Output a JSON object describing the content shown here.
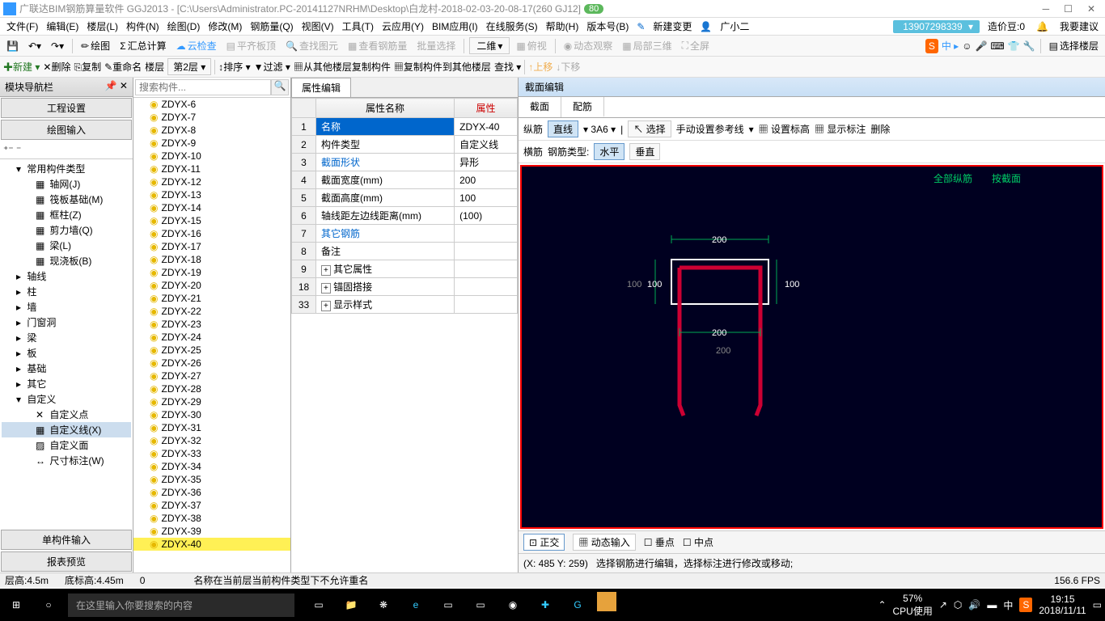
{
  "title": "广联达BIM钢筋算量软件 GGJ2013 - [C:\\Users\\Administrator.PC-20141127NRHM\\Desktop\\白龙村-2018-02-03-20-08-17(260 GJ12]",
  "badge": "80",
  "menu": [
    "文件(F)",
    "编辑(E)",
    "楼层(L)",
    "构件(N)",
    "绘图(D)",
    "修改(M)",
    "钢筋量(Q)",
    "视图(V)",
    "工具(T)",
    "云应用(Y)",
    "BIM应用(I)",
    "在线服务(S)",
    "帮助(H)",
    "版本号(B)"
  ],
  "menuRight": {
    "newChange": "新建变更",
    "user": "广小二",
    "phone": "13907298339",
    "cost": "造价豆:0",
    "suggest": "我要建议"
  },
  "toolbar1": [
    "绘图",
    "汇总计算",
    "云检查",
    "平齐板顶",
    "查找图元",
    "查看钢筋量",
    "批量选择",
    "二维",
    "俯视",
    "动态观察",
    "局部三维",
    "全屏",
    "选择楼层"
  ],
  "toolbar2": {
    "new": "新建",
    "del": "删除",
    "copy": "复制",
    "rename": "重命名",
    "floor": "楼层",
    "floorNum": "第2层",
    "sort": "排序",
    "filter": "过滤",
    "copyFrom": "从其他楼层复制构件",
    "copyTo": "复制构件到其他楼层",
    "find": "查找",
    "up": "上移",
    "down": "下移"
  },
  "leftHeader": "模块导航栏",
  "sections": {
    "proj": "工程设置",
    "draw": "绘图输入",
    "single": "单构件输入",
    "report": "报表预览"
  },
  "tree": [
    {
      "l": 1,
      "exp": "▾",
      "t": "常用构件类型"
    },
    {
      "l": 2,
      "ico": "▦",
      "t": "轴网(J)"
    },
    {
      "l": 2,
      "ico": "▦",
      "t": "筏板基础(M)"
    },
    {
      "l": 2,
      "ico": "▦",
      "t": "框柱(Z)"
    },
    {
      "l": 2,
      "ico": "▦",
      "t": "剪力墙(Q)"
    },
    {
      "l": 2,
      "ico": "▦",
      "t": "梁(L)"
    },
    {
      "l": 2,
      "ico": "▦",
      "t": "现浇板(B)"
    },
    {
      "l": 1,
      "exp": "▸",
      "t": "轴线"
    },
    {
      "l": 1,
      "exp": "▸",
      "t": "柱"
    },
    {
      "l": 1,
      "exp": "▸",
      "t": "墙"
    },
    {
      "l": 1,
      "exp": "▸",
      "t": "门窗洞"
    },
    {
      "l": 1,
      "exp": "▸",
      "t": "梁"
    },
    {
      "l": 1,
      "exp": "▸",
      "t": "板"
    },
    {
      "l": 1,
      "exp": "▸",
      "t": "基础"
    },
    {
      "l": 1,
      "exp": "▸",
      "t": "其它"
    },
    {
      "l": 1,
      "exp": "▾",
      "t": "自定义"
    },
    {
      "l": 2,
      "ico": "✕",
      "t": "自定义点"
    },
    {
      "l": 2,
      "ico": "▦",
      "t": "自定义线(X)",
      "sel": true
    },
    {
      "l": 2,
      "ico": "▨",
      "t": "自定义面"
    },
    {
      "l": 2,
      "ico": "↔",
      "t": "尺寸标注(W)"
    }
  ],
  "searchPlaceholder": "搜索构件...",
  "itemList": [
    "ZDYX-6",
    "ZDYX-7",
    "ZDYX-8",
    "ZDYX-9",
    "ZDYX-10",
    "ZDYX-11",
    "ZDYX-12",
    "ZDYX-13",
    "ZDYX-14",
    "ZDYX-15",
    "ZDYX-16",
    "ZDYX-17",
    "ZDYX-18",
    "ZDYX-19",
    "ZDYX-20",
    "ZDYX-21",
    "ZDYX-22",
    "ZDYX-23",
    "ZDYX-24",
    "ZDYX-25",
    "ZDYX-26",
    "ZDYX-27",
    "ZDYX-28",
    "ZDYX-29",
    "ZDYX-30",
    "ZDYX-31",
    "ZDYX-32",
    "ZDYX-33",
    "ZDYX-34",
    "ZDYX-35",
    "ZDYX-36",
    "ZDYX-37",
    "ZDYX-38",
    "ZDYX-39",
    "ZDYX-40"
  ],
  "itemSelected": "ZDYX-40",
  "propTab": "属性编辑",
  "propHeaders": {
    "name": "属性名称",
    "val": "属性"
  },
  "props": [
    {
      "n": "1",
      "k": "名称",
      "v": "ZDYX-40",
      "sel": true
    },
    {
      "n": "2",
      "k": "构件类型",
      "v": "自定义线"
    },
    {
      "n": "3",
      "k": "截面形状",
      "v": "异形",
      "link": true
    },
    {
      "n": "4",
      "k": "截面宽度(mm)",
      "v": "200"
    },
    {
      "n": "5",
      "k": "截面高度(mm)",
      "v": "100"
    },
    {
      "n": "6",
      "k": "轴线距左边线距离(mm)",
      "v": "(100)"
    },
    {
      "n": "7",
      "k": "其它钢筋",
      "v": "",
      "link": true
    },
    {
      "n": "8",
      "k": "备注",
      "v": ""
    },
    {
      "n": "9",
      "k": "其它属性",
      "v": "",
      "exp": "+"
    },
    {
      "n": "18",
      "k": "锚固搭接",
      "v": "",
      "exp": "+"
    },
    {
      "n": "33",
      "k": "显示样式",
      "v": "",
      "exp": "+"
    }
  ],
  "sectionHdr": "截面编辑",
  "secTabs": {
    "section": "截面",
    "rebar": "配筋"
  },
  "secTb1": {
    "vbar": "纵筋",
    "line": "直线",
    "spec": "3A6",
    "select": "选择",
    "manual": "手动设置参考线",
    "elev": "设置标高",
    "show": "显示标注",
    "del": "删除"
  },
  "secTb2": {
    "hbar": "横筋",
    "type": "钢筋类型:",
    "horiz": "水平",
    "vert": "垂直"
  },
  "canvasLabels": {
    "allV": "全部纵筋",
    "bySec": "按截面",
    "d200a": "200",
    "d100l": "100",
    "d100l2": "100",
    "d100r": "100",
    "d200b": "200",
    "d200c": "200"
  },
  "botBtns": {
    "ortho": "正交",
    "dyn": "动态输入",
    "perp": "垂点",
    "mid": "中点"
  },
  "coords": "(X: 485 Y: 259)",
  "hint": "选择钢筋进行编辑，选择标注进行修改或移动;",
  "status": {
    "h": "层高:4.5m",
    "bh": "底标高:4.45m",
    "z": "0",
    "msg": "名称在当前层当前构件类型下不允许重名",
    "fps": "156.6 FPS"
  },
  "taskbar": {
    "search": "在这里输入你要搜索的内容",
    "cpu": "57%",
    "cpulbl": "CPU使用",
    "time": "19:15",
    "date": "2018/11/11",
    "ime": "中"
  }
}
